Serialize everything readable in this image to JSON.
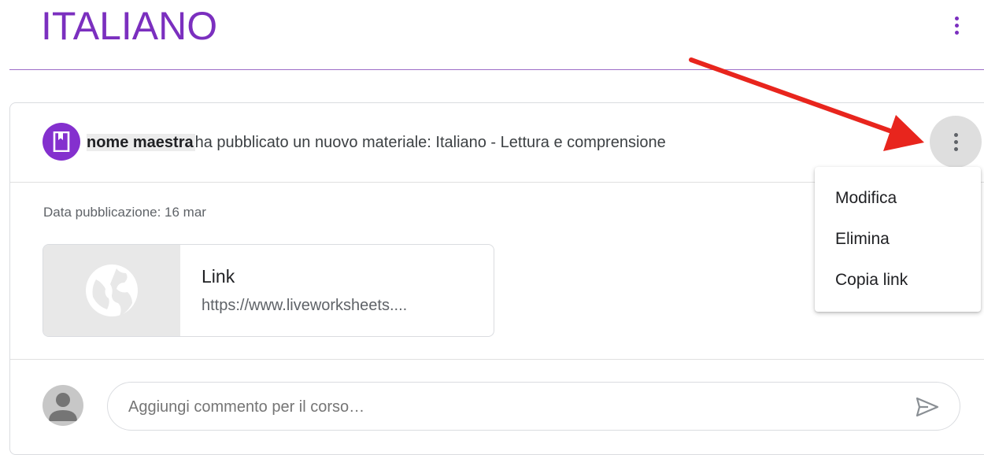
{
  "header": {
    "course_title": "ITALIANO",
    "more_icon": "vertical-dots-icon"
  },
  "post": {
    "author": "nome maestra",
    "headline": "ha pubblicato un nuovo materiale: Italiano - Lettura e comprensione",
    "avatar_icon": "bookmark-icon",
    "more_icon": "vertical-dots-icon",
    "date_label": "Data pubblicazione: 16 mar",
    "attachment": {
      "title": "Link",
      "url": "https://www.liveworksheets....",
      "thumb_icon": "globe-icon"
    }
  },
  "comment": {
    "placeholder": "Aggiungi commento per il corso…",
    "send_icon": "send-icon",
    "user_icon": "user-avatar-icon"
  },
  "menu": {
    "items": [
      {
        "label": "Modifica"
      },
      {
        "label": "Elimina"
      },
      {
        "label": "Copia link"
      }
    ]
  },
  "colors": {
    "accent": "#7b2fbf",
    "avatar_bg": "#8430ce",
    "annotation_arrow": "#e8251d"
  }
}
